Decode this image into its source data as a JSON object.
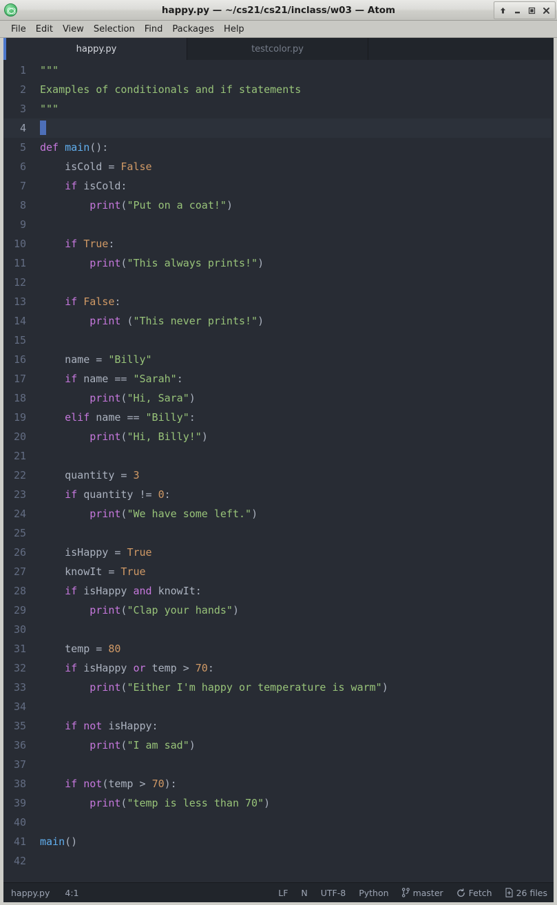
{
  "window": {
    "title": "happy.py — ~/cs21/cs21/inclass/w03 — Atom",
    "app_icon": "atom-icon",
    "controls": [
      {
        "name": "shade-button",
        "glyph": "up-arrow-icon"
      },
      {
        "name": "minimize-button",
        "glyph": "minimize-icon"
      },
      {
        "name": "maximize-button",
        "glyph": "maximize-icon"
      },
      {
        "name": "close-button",
        "glyph": "close-icon"
      }
    ]
  },
  "menubar": {
    "items": [
      {
        "label": "File"
      },
      {
        "label": "Edit"
      },
      {
        "label": "View"
      },
      {
        "label": "Selection"
      },
      {
        "label": "Find"
      },
      {
        "label": "Packages"
      },
      {
        "label": "Help"
      }
    ]
  },
  "tabs": [
    {
      "label": "happy.py",
      "active": true
    },
    {
      "label": "testcolor.py",
      "active": false
    }
  ],
  "editor": {
    "language": "Python",
    "cursor_line": 4,
    "total_lines": 42,
    "lines": [
      {
        "n": "1",
        "tokens": [
          {
            "t": "\"\"\"",
            "c": "str"
          }
        ]
      },
      {
        "n": "2",
        "tokens": [
          {
            "t": "Examples of conditionals and if statements",
            "c": "str"
          }
        ]
      },
      {
        "n": "3",
        "tokens": [
          {
            "t": "\"\"\"",
            "c": "str"
          }
        ]
      },
      {
        "n": "4",
        "tokens": [],
        "cursor": true
      },
      {
        "n": "5",
        "tokens": [
          {
            "t": "def",
            "c": "k"
          },
          {
            "t": " ",
            "c": "pn"
          },
          {
            "t": "main",
            "c": "fn"
          },
          {
            "t": "():",
            "c": "pn"
          }
        ]
      },
      {
        "n": "6",
        "tokens": [
          {
            "t": "    isCold ",
            "c": "pn"
          },
          {
            "t": "=",
            "c": "op"
          },
          {
            "t": " ",
            "c": "pn"
          },
          {
            "t": "False",
            "c": "num"
          }
        ]
      },
      {
        "n": "7",
        "tokens": [
          {
            "t": "    ",
            "c": "pn"
          },
          {
            "t": "if",
            "c": "k"
          },
          {
            "t": " isCold:",
            "c": "pn"
          }
        ]
      },
      {
        "n": "8",
        "tokens": [
          {
            "t": "        ",
            "c": "pn"
          },
          {
            "t": "print",
            "c": "bi"
          },
          {
            "t": "(",
            "c": "pn"
          },
          {
            "t": "\"Put on a coat!\"",
            "c": "str"
          },
          {
            "t": ")",
            "c": "pn"
          }
        ]
      },
      {
        "n": "9",
        "tokens": []
      },
      {
        "n": "10",
        "tokens": [
          {
            "t": "    ",
            "c": "pn"
          },
          {
            "t": "if",
            "c": "k"
          },
          {
            "t": " ",
            "c": "pn"
          },
          {
            "t": "True",
            "c": "num"
          },
          {
            "t": ":",
            "c": "pn"
          }
        ]
      },
      {
        "n": "11",
        "tokens": [
          {
            "t": "        ",
            "c": "pn"
          },
          {
            "t": "print",
            "c": "bi"
          },
          {
            "t": "(",
            "c": "pn"
          },
          {
            "t": "\"This always prints!\"",
            "c": "str"
          },
          {
            "t": ")",
            "c": "pn"
          }
        ]
      },
      {
        "n": "12",
        "tokens": []
      },
      {
        "n": "13",
        "tokens": [
          {
            "t": "    ",
            "c": "pn"
          },
          {
            "t": "if",
            "c": "k"
          },
          {
            "t": " ",
            "c": "pn"
          },
          {
            "t": "False",
            "c": "num"
          },
          {
            "t": ":",
            "c": "pn"
          }
        ]
      },
      {
        "n": "14",
        "tokens": [
          {
            "t": "        ",
            "c": "pn"
          },
          {
            "t": "print",
            "c": "bi"
          },
          {
            "t": " (",
            "c": "pn"
          },
          {
            "t": "\"This never prints!\"",
            "c": "str"
          },
          {
            "t": ")",
            "c": "pn"
          }
        ]
      },
      {
        "n": "15",
        "tokens": []
      },
      {
        "n": "16",
        "tokens": [
          {
            "t": "    name ",
            "c": "pn"
          },
          {
            "t": "=",
            "c": "op"
          },
          {
            "t": " ",
            "c": "pn"
          },
          {
            "t": "\"Billy\"",
            "c": "str"
          }
        ]
      },
      {
        "n": "17",
        "tokens": [
          {
            "t": "    ",
            "c": "pn"
          },
          {
            "t": "if",
            "c": "k"
          },
          {
            "t": " name ",
            "c": "pn"
          },
          {
            "t": "==",
            "c": "op"
          },
          {
            "t": " ",
            "c": "pn"
          },
          {
            "t": "\"Sarah\"",
            "c": "str"
          },
          {
            "t": ":",
            "c": "pn"
          }
        ]
      },
      {
        "n": "18",
        "tokens": [
          {
            "t": "        ",
            "c": "pn"
          },
          {
            "t": "print",
            "c": "bi"
          },
          {
            "t": "(",
            "c": "pn"
          },
          {
            "t": "\"Hi, Sara\"",
            "c": "str"
          },
          {
            "t": ")",
            "c": "pn"
          }
        ]
      },
      {
        "n": "19",
        "tokens": [
          {
            "t": "    ",
            "c": "pn"
          },
          {
            "t": "elif",
            "c": "k"
          },
          {
            "t": " name ",
            "c": "pn"
          },
          {
            "t": "==",
            "c": "op"
          },
          {
            "t": " ",
            "c": "pn"
          },
          {
            "t": "\"Billy\"",
            "c": "str"
          },
          {
            "t": ":",
            "c": "pn"
          }
        ]
      },
      {
        "n": "20",
        "tokens": [
          {
            "t": "        ",
            "c": "pn"
          },
          {
            "t": "print",
            "c": "bi"
          },
          {
            "t": "(",
            "c": "pn"
          },
          {
            "t": "\"Hi, Billy!\"",
            "c": "str"
          },
          {
            "t": ")",
            "c": "pn"
          }
        ]
      },
      {
        "n": "21",
        "tokens": []
      },
      {
        "n": "22",
        "tokens": [
          {
            "t": "    quantity ",
            "c": "pn"
          },
          {
            "t": "=",
            "c": "op"
          },
          {
            "t": " ",
            "c": "pn"
          },
          {
            "t": "3",
            "c": "num"
          }
        ]
      },
      {
        "n": "23",
        "tokens": [
          {
            "t": "    ",
            "c": "pn"
          },
          {
            "t": "if",
            "c": "k"
          },
          {
            "t": " quantity ",
            "c": "pn"
          },
          {
            "t": "!=",
            "c": "op"
          },
          {
            "t": " ",
            "c": "pn"
          },
          {
            "t": "0",
            "c": "num"
          },
          {
            "t": ":",
            "c": "pn"
          }
        ]
      },
      {
        "n": "24",
        "tokens": [
          {
            "t": "        ",
            "c": "pn"
          },
          {
            "t": "print",
            "c": "bi"
          },
          {
            "t": "(",
            "c": "pn"
          },
          {
            "t": "\"We have some left.\"",
            "c": "str"
          },
          {
            "t": ")",
            "c": "pn"
          }
        ]
      },
      {
        "n": "25",
        "tokens": []
      },
      {
        "n": "26",
        "tokens": [
          {
            "t": "    isHappy ",
            "c": "pn"
          },
          {
            "t": "=",
            "c": "op"
          },
          {
            "t": " ",
            "c": "pn"
          },
          {
            "t": "True",
            "c": "num"
          }
        ]
      },
      {
        "n": "27",
        "tokens": [
          {
            "t": "    knowIt ",
            "c": "pn"
          },
          {
            "t": "=",
            "c": "op"
          },
          {
            "t": " ",
            "c": "pn"
          },
          {
            "t": "True",
            "c": "num"
          }
        ]
      },
      {
        "n": "28",
        "tokens": [
          {
            "t": "    ",
            "c": "pn"
          },
          {
            "t": "if",
            "c": "k"
          },
          {
            "t": " isHappy ",
            "c": "pn"
          },
          {
            "t": "and",
            "c": "k"
          },
          {
            "t": " knowIt:",
            "c": "pn"
          }
        ]
      },
      {
        "n": "29",
        "tokens": [
          {
            "t": "        ",
            "c": "pn"
          },
          {
            "t": "print",
            "c": "bi"
          },
          {
            "t": "(",
            "c": "pn"
          },
          {
            "t": "\"Clap your hands\"",
            "c": "str"
          },
          {
            "t": ")",
            "c": "pn"
          }
        ]
      },
      {
        "n": "30",
        "tokens": []
      },
      {
        "n": "31",
        "tokens": [
          {
            "t": "    temp ",
            "c": "pn"
          },
          {
            "t": "=",
            "c": "op"
          },
          {
            "t": " ",
            "c": "pn"
          },
          {
            "t": "80",
            "c": "num"
          }
        ]
      },
      {
        "n": "32",
        "tokens": [
          {
            "t": "    ",
            "c": "pn"
          },
          {
            "t": "if",
            "c": "k"
          },
          {
            "t": " isHappy ",
            "c": "pn"
          },
          {
            "t": "or",
            "c": "k"
          },
          {
            "t": " temp ",
            "c": "pn"
          },
          {
            "t": ">",
            "c": "op"
          },
          {
            "t": " ",
            "c": "pn"
          },
          {
            "t": "70",
            "c": "num"
          },
          {
            "t": ":",
            "c": "pn"
          }
        ]
      },
      {
        "n": "33",
        "tokens": [
          {
            "t": "        ",
            "c": "pn"
          },
          {
            "t": "print",
            "c": "bi"
          },
          {
            "t": "(",
            "c": "pn"
          },
          {
            "t": "\"Either I'm happy or temperature is warm\"",
            "c": "str"
          },
          {
            "t": ")",
            "c": "pn"
          }
        ]
      },
      {
        "n": "34",
        "tokens": []
      },
      {
        "n": "35",
        "tokens": [
          {
            "t": "    ",
            "c": "pn"
          },
          {
            "t": "if",
            "c": "k"
          },
          {
            "t": " ",
            "c": "pn"
          },
          {
            "t": "not",
            "c": "k"
          },
          {
            "t": " isHappy:",
            "c": "pn"
          }
        ]
      },
      {
        "n": "36",
        "tokens": [
          {
            "t": "        ",
            "c": "pn"
          },
          {
            "t": "print",
            "c": "bi"
          },
          {
            "t": "(",
            "c": "pn"
          },
          {
            "t": "\"I am sad\"",
            "c": "str"
          },
          {
            "t": ")",
            "c": "pn"
          }
        ]
      },
      {
        "n": "37",
        "tokens": []
      },
      {
        "n": "38",
        "tokens": [
          {
            "t": "    ",
            "c": "pn"
          },
          {
            "t": "if",
            "c": "k"
          },
          {
            "t": " ",
            "c": "pn"
          },
          {
            "t": "not",
            "c": "k"
          },
          {
            "t": "(temp ",
            "c": "pn"
          },
          {
            "t": ">",
            "c": "op"
          },
          {
            "t": " ",
            "c": "pn"
          },
          {
            "t": "70",
            "c": "num"
          },
          {
            "t": "):",
            "c": "pn"
          }
        ]
      },
      {
        "n": "39",
        "tokens": [
          {
            "t": "        ",
            "c": "pn"
          },
          {
            "t": "print",
            "c": "bi"
          },
          {
            "t": "(",
            "c": "pn"
          },
          {
            "t": "\"temp is less than 70\"",
            "c": "str"
          },
          {
            "t": ")",
            "c": "pn"
          }
        ]
      },
      {
        "n": "40",
        "tokens": []
      },
      {
        "n": "41",
        "tokens": [
          {
            "t": "main",
            "c": "fn"
          },
          {
            "t": "()",
            "c": "pn"
          }
        ]
      },
      {
        "n": "42",
        "tokens": []
      }
    ]
  },
  "statusbar": {
    "filename": "happy.py",
    "cursor_position": "4:1",
    "line_ending": "LF",
    "selection_mode": "N",
    "encoding": "UTF-8",
    "grammar": "Python",
    "branch": "master",
    "fetch_label": "Fetch",
    "files_label": "26 files"
  },
  "colors": {
    "titlebar_bg": "#cfcfca",
    "menubar_bg": "#c9c9c4",
    "tabbar_bg": "#21252b",
    "editor_bg": "#282c34",
    "statusbar_bg": "#21252b",
    "accent": "#4d78cc",
    "keyword": "#c678dd",
    "function": "#61afef",
    "string": "#98c379",
    "number": "#d19a66",
    "text": "#abb2bf",
    "gutter": "#636d83",
    "cursor": "#4d6fb8"
  }
}
